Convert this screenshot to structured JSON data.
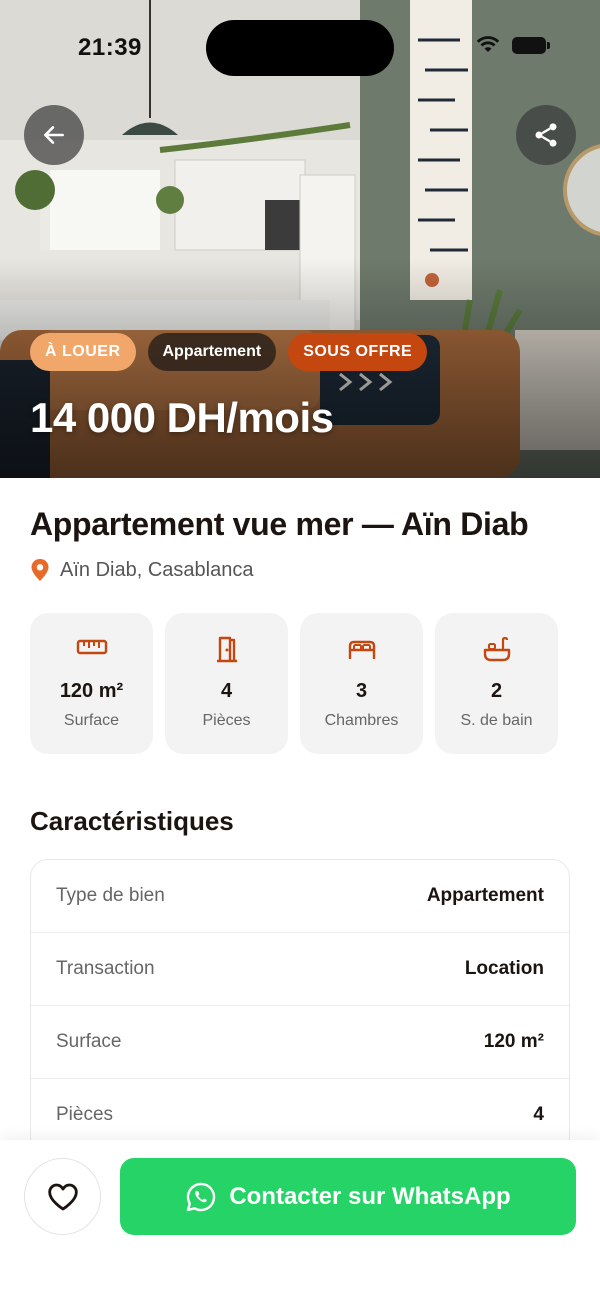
{
  "status_bar": {
    "time": "21:39"
  },
  "hero": {
    "badges": {
      "transaction": "À LOUER",
      "property_type": "Appartement",
      "status": "SOUS OFFRE"
    },
    "price": "14 000 DH/mois"
  },
  "listing": {
    "title": "Appartement vue mer — Aïn Diab",
    "location": "Aïn Diab, Casablanca",
    "stats": [
      {
        "icon": "ruler-icon",
        "value": "120 m²",
        "label": "Surface"
      },
      {
        "icon": "door-icon",
        "value": "4",
        "label": "Pièces"
      },
      {
        "icon": "bed-icon",
        "value": "3",
        "label": "Chambres"
      },
      {
        "icon": "bath-icon",
        "value": "2",
        "label": "S. de bain"
      }
    ]
  },
  "characteristics": {
    "title": "Caractéristiques",
    "rows": [
      {
        "label": "Type de bien",
        "value": "Appartement"
      },
      {
        "label": "Transaction",
        "value": "Location"
      },
      {
        "label": "Surface",
        "value": "120 m²"
      },
      {
        "label": "Pièces",
        "value": "4"
      }
    ]
  },
  "bottom_bar": {
    "contact_label": "Contacter sur WhatsApp"
  },
  "colors": {
    "accent": "#c4470f",
    "rent_badge": "#f2a76a",
    "whatsapp": "#25d366",
    "icon_accent": "#c4470f",
    "location_pin": "#e86a2a"
  }
}
